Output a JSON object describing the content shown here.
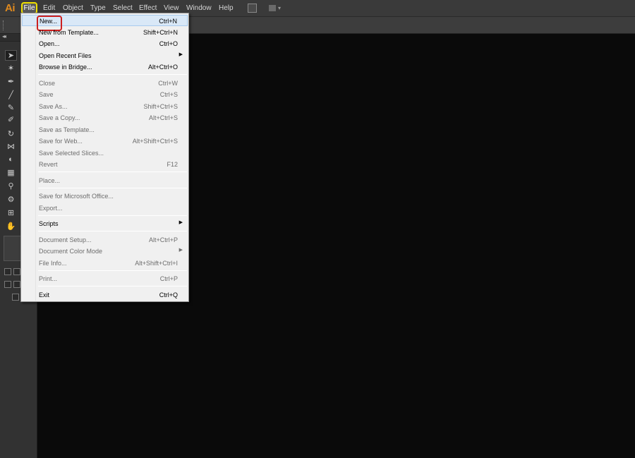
{
  "app": {
    "logo": "Ai"
  },
  "menubar": {
    "items": [
      "File",
      "Edit",
      "Object",
      "Type",
      "Select",
      "Effect",
      "View",
      "Window",
      "Help"
    ],
    "icons": [
      "bridge-icon",
      "arrange-documents-icon",
      "dropdown-arrow-icon"
    ]
  },
  "panel": {
    "collapse_glyph": "◂◂"
  },
  "tools": [
    {
      "name": "selection-tool",
      "glyph": "➤"
    },
    {
      "name": "magic-wand-tool",
      "glyph": "✶"
    },
    {
      "name": "pen-tool",
      "glyph": "✒"
    },
    {
      "name": "line-segment-tool",
      "glyph": "╱"
    },
    {
      "name": "paintbrush-tool",
      "glyph": "✎"
    },
    {
      "name": "blob-brush-tool",
      "glyph": "✐"
    },
    {
      "name": "rotate-tool",
      "glyph": "↻"
    },
    {
      "name": "width-tool",
      "glyph": "⋈"
    },
    {
      "name": "shape-builder-tool",
      "glyph": "◐"
    },
    {
      "name": "mesh-tool",
      "glyph": "▦"
    },
    {
      "name": "eyedropper-tool",
      "glyph": "⚲"
    },
    {
      "name": "symbol-sprayer-tool",
      "glyph": "⚙"
    },
    {
      "name": "artboard-tool",
      "glyph": "⊞"
    },
    {
      "name": "hand-tool",
      "glyph": "✋"
    }
  ],
  "file_menu": {
    "items": [
      {
        "label": "New...",
        "shortcut": "Ctrl+N",
        "enabled": true,
        "highlighted": true
      },
      {
        "label": "New from Template...",
        "shortcut": "Shift+Ctrl+N",
        "enabled": true
      },
      {
        "label": "Open...",
        "shortcut": "Ctrl+O",
        "enabled": true
      },
      {
        "label": "Open Recent Files",
        "shortcut": "",
        "enabled": true,
        "submenu": true
      },
      {
        "label": "Browse in Bridge...",
        "shortcut": "Alt+Ctrl+O",
        "enabled": true
      },
      {
        "label": "Close",
        "shortcut": "Ctrl+W",
        "enabled": false
      },
      {
        "label": "Save",
        "shortcut": "Ctrl+S",
        "enabled": false
      },
      {
        "label": "Save As...",
        "shortcut": "Shift+Ctrl+S",
        "enabled": false
      },
      {
        "label": "Save a Copy...",
        "shortcut": "Alt+Ctrl+S",
        "enabled": false
      },
      {
        "label": "Save as Template...",
        "shortcut": "",
        "enabled": false
      },
      {
        "label": "Save for Web...",
        "shortcut": "Alt+Shift+Ctrl+S",
        "enabled": false
      },
      {
        "label": "Save Selected Slices...",
        "shortcut": "",
        "enabled": false
      },
      {
        "label": "Revert",
        "shortcut": "F12",
        "enabled": false
      },
      {
        "label": "Place...",
        "shortcut": "",
        "enabled": false
      },
      {
        "label": "Save for Microsoft Office...",
        "shortcut": "",
        "enabled": false
      },
      {
        "label": "Export...",
        "shortcut": "",
        "enabled": false
      },
      {
        "label": "Scripts",
        "shortcut": "",
        "enabled": true,
        "submenu": true
      },
      {
        "label": "Document Setup...",
        "shortcut": "Alt+Ctrl+P",
        "enabled": false
      },
      {
        "label": "Document Color Mode",
        "shortcut": "",
        "enabled": false,
        "submenu": true
      },
      {
        "label": "File Info...",
        "shortcut": "Alt+Shift+Ctrl+I",
        "enabled": false
      },
      {
        "label": "Print...",
        "shortcut": "Ctrl+P",
        "enabled": false
      },
      {
        "label": "Exit",
        "shortcut": "Ctrl+Q",
        "enabled": true
      }
    ]
  },
  "colors": {
    "logo": "#e08a1e",
    "file_highlight_border": "#f0e000",
    "new_highlight_border": "#cc1f1f",
    "canvas": "#0a0a0a"
  }
}
